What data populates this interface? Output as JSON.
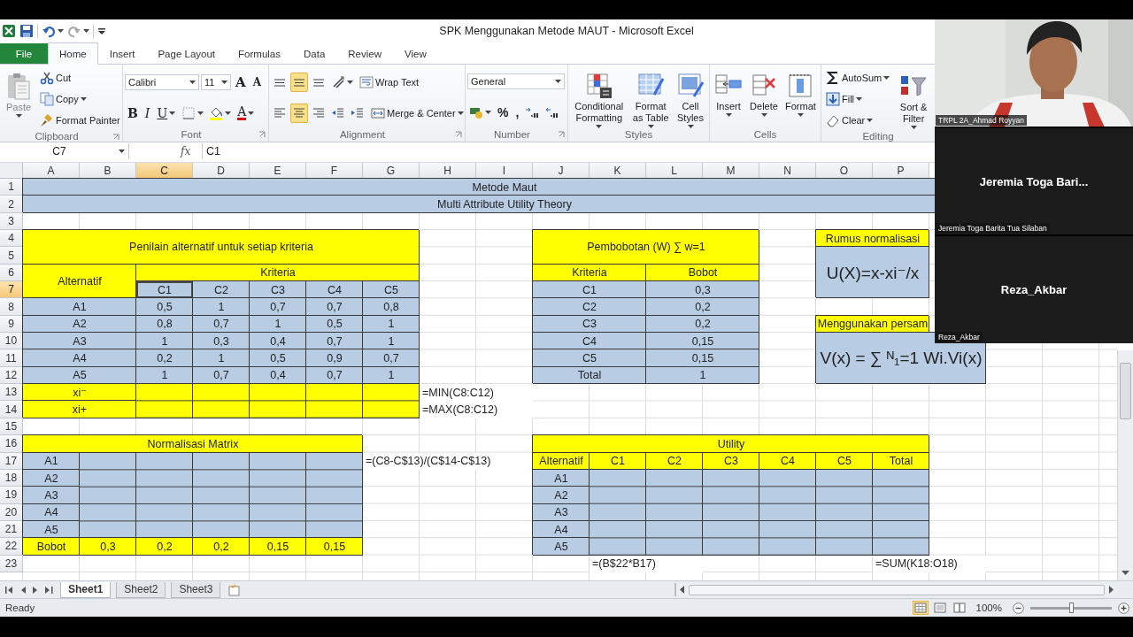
{
  "window": {
    "title": "SPK Menggunakan Metode MAUT - Microsoft Excel"
  },
  "quick_access": [
    {
      "kind": "excel",
      "menu": false
    },
    {
      "kind": "save",
      "menu": false
    },
    {
      "kind": "undo",
      "menu": true
    },
    {
      "kind": "redo",
      "menu": true
    },
    {
      "kind": "customize",
      "menu": false
    }
  ],
  "tabs": [
    {
      "label": "File",
      "kind": "file",
      "selected": false
    },
    {
      "label": "Home",
      "kind": "tab",
      "selected": true
    },
    {
      "label": "Insert",
      "kind": "tab",
      "selected": false
    },
    {
      "label": "Page Layout",
      "kind": "tab",
      "selected": false
    },
    {
      "label": "Formulas",
      "kind": "tab",
      "selected": false
    },
    {
      "label": "Data",
      "kind": "tab",
      "selected": false
    },
    {
      "label": "Review",
      "kind": "tab",
      "selected": false
    },
    {
      "label": "View",
      "kind": "tab",
      "selected": false
    }
  ],
  "ribbon": {
    "groups": [
      {
        "label": "Clipboard",
        "launcher": true,
        "columns": [
          [
            [
              {
                "kind": "paste",
                "label": "Paste",
                "menu": true,
                "selected": false
              }
            ]
          ],
          [
            [
              {
                "kind": "cut",
                "label": "Cut",
                "menu": false,
                "selected": false
              }
            ],
            [
              {
                "kind": "copy",
                "label": "Copy",
                "menu": true,
                "selected": false
              }
            ],
            [
              {
                "kind": "painter",
                "label": "Format Painter",
                "menu": false,
                "selected": false
              }
            ]
          ]
        ]
      },
      {
        "label": "Font",
        "launcher": true,
        "columns": [
          [
            [
              {
                "kind": "font-name",
                "label": "Calibri",
                "menu": true,
                "selected": false
              },
              {
                "kind": "font-size",
                "label": "11",
                "menu": true,
                "selected": false
              },
              {
                "kind": "grow",
                "label": "A",
                "menu": false,
                "selected": false
              },
              {
                "kind": "shrink",
                "label": "A",
                "menu": false,
                "selected": false
              }
            ],
            [
              {
                "kind": "bold",
                "label": "B",
                "menu": false,
                "selected": false
              },
              {
                "kind": "italic",
                "label": "I",
                "menu": false,
                "selected": false
              },
              {
                "kind": "underline",
                "label": "U",
                "menu": true,
                "selected": false
              },
              {
                "kind": "borders",
                "menu": true,
                "selected": false
              },
              {
                "kind": "fill-color",
                "menu": true,
                "selected": false
              },
              {
                "kind": "font-color",
                "label": "A",
                "menu": true,
                "selected": false
              }
            ]
          ]
        ]
      },
      {
        "label": "Alignment",
        "launcher": true,
        "columns": [
          [
            [
              {
                "kind": "align-top",
                "menu": false,
                "selected": false
              },
              {
                "kind": "align-middle",
                "menu": false,
                "selected": true
              },
              {
                "kind": "align-bottom",
                "menu": false,
                "selected": false
              },
              {
                "kind": "orientation",
                "menu": true,
                "selected": false
              },
              {
                "kind": "wrap",
                "label": "Wrap Text",
                "menu": false,
                "selected": false
              }
            ],
            [
              {
                "kind": "align-left",
                "menu": false,
                "selected": false
              },
              {
                "kind": "align-center",
                "menu": false,
                "selected": true
              },
              {
                "kind": "align-right",
                "menu": false,
                "selected": false
              },
              {
                "kind": "outdent",
                "menu": false,
                "selected": false
              },
              {
                "kind": "indent",
                "menu": false,
                "selected": false
              },
              {
                "kind": "merge",
                "label": "Merge & Center",
                "menu": true,
                "selected": false
              }
            ]
          ]
        ]
      },
      {
        "label": "Number",
        "launcher": true,
        "columns": [
          [
            [
              {
                "kind": "number-format",
                "label": "General",
                "menu": true,
                "selected": false
              }
            ],
            [
              {
                "kind": "currency",
                "menu": true,
                "selected": false
              },
              {
                "kind": "percent",
                "label": "%",
                "menu": false,
                "selected": false
              },
              {
                "kind": "comma",
                "label": ",",
                "menu": false,
                "selected": false
              },
              {
                "kind": "inc-decimal",
                "menu": false,
                "selected": false
              },
              {
                "kind": "dec-decimal",
                "menu": false,
                "selected": false
              }
            ]
          ]
        ]
      },
      {
        "label": "Styles",
        "launcher": false,
        "columns": [
          [
            [
              {
                "kind": "conditional",
                "label": "Conditional Formatting",
                "menu": true,
                "selected": false
              }
            ]
          ],
          [
            [
              {
                "kind": "format-table",
                "label": "Format as Table",
                "menu": true,
                "selected": false
              }
            ]
          ],
          [
            [
              {
                "kind": "cell-styles",
                "label": "Cell Styles",
                "menu": true,
                "selected": false
              }
            ]
          ]
        ]
      },
      {
        "label": "Cells",
        "launcher": false,
        "columns": [
          [
            [
              {
                "kind": "insert-cells",
                "label": "Insert",
                "menu": true,
                "selected": false
              }
            ]
          ],
          [
            [
              {
                "kind": "delete-cells",
                "label": "Delete",
                "menu": true,
                "selected": false
              }
            ]
          ],
          [
            [
              {
                "kind": "format-cells",
                "label": "Format",
                "menu": true,
                "selected": false
              }
            ]
          ]
        ]
      },
      {
        "label": "Editing",
        "launcher": false,
        "columns": [
          [
            [
              {
                "kind": "autosum",
                "label": "AutoSum",
                "menu": true,
                "selected": false
              }
            ],
            [
              {
                "kind": "fill",
                "label": "Fill",
                "menu": true,
                "selected": false
              }
            ],
            [
              {
                "kind": "clear",
                "label": "Clear",
                "menu": true,
                "selected": false
              }
            ]
          ],
          [
            [
              {
                "kind": "sort",
                "label": "Sort & Filter",
                "menu": true,
                "selected": false
              }
            ]
          ]
        ]
      }
    ]
  },
  "formula_bar": {
    "name_box": "C7",
    "fx": "fx",
    "formula": "C1"
  },
  "sheet": {
    "columns": [
      {
        "label": "A",
        "selected": false
      },
      {
        "label": "B",
        "selected": false
      },
      {
        "label": "C",
        "selected": true
      },
      {
        "label": "D",
        "selected": false
      },
      {
        "label": "E",
        "selected": false
      },
      {
        "label": "F",
        "selected": false
      },
      {
        "label": "G",
        "selected": false
      },
      {
        "label": "H",
        "selected": false
      },
      {
        "label": "I",
        "selected": false
      },
      {
        "label": "J",
        "selected": false
      },
      {
        "label": "K",
        "selected": false
      },
      {
        "label": "L",
        "selected": false
      },
      {
        "label": "M",
        "selected": false
      },
      {
        "label": "N",
        "selected": false
      },
      {
        "label": "O",
        "selected": false
      },
      {
        "label": "P",
        "selected": false
      }
    ],
    "rows": [
      {
        "label": "1",
        "selected": false
      },
      {
        "label": "2",
        "selected": false
      },
      {
        "label": "3",
        "selected": false
      },
      {
        "label": "4",
        "selected": false
      },
      {
        "label": "5",
        "selected": false
      },
      {
        "label": "6",
        "selected": false
      },
      {
        "label": "7",
        "selected": true
      },
      {
        "label": "8",
        "selected": false
      },
      {
        "label": "9",
        "selected": false
      },
      {
        "label": "10",
        "selected": false
      },
      {
        "label": "11",
        "selected": false
      },
      {
        "label": "12",
        "selected": false
      },
      {
        "label": "13",
        "selected": false
      },
      {
        "label": "14",
        "selected": false
      },
      {
        "label": "15",
        "selected": false
      },
      {
        "label": "16",
        "selected": false
      },
      {
        "label": "17",
        "selected": false
      },
      {
        "label": "18",
        "selected": false
      },
      {
        "label": "19",
        "selected": false
      },
      {
        "label": "20",
        "selected": false
      },
      {
        "label": "21",
        "selected": false
      },
      {
        "label": "22",
        "selected": false
      },
      {
        "label": "23",
        "selected": false
      }
    ],
    "cells": [
      {
        "text": "Metode Maut",
        "color": "#b8cce4",
        "selected": false
      },
      {
        "text": "Multi Attribute Utility Theory",
        "color": "#b8cce4",
        "selected": false
      },
      {
        "text": "Penilain alternatif untuk setiap kriteria",
        "color": "#ffff00",
        "selected": false
      },
      {
        "text": "Pembobotan (W) ∑ w=1",
        "color": "#ffff00",
        "selected": false
      },
      {
        "text": "Rumus normalisasi",
        "color": "#ffff00",
        "selected": false
      },
      {
        "text": "Alternatif",
        "color": "#ffff00",
        "selected": false
      },
      {
        "text": "Kriteria",
        "color": "#ffff00",
        "selected": false
      },
      {
        "text": "Kriteria",
        "color": "#ffff00",
        "selected": false
      },
      {
        "text": "Bobot",
        "color": "#ffff00",
        "selected": false
      },
      {
        "text": "U(X)=x-xi⁻/x",
        "color": "#b8cce4",
        "kind": "big",
        "selected": false
      },
      {
        "text": "C1",
        "color": "#b8cce4",
        "selected": true
      },
      {
        "text": "C2",
        "color": "#b8cce4",
        "selected": false
      },
      {
        "text": "C3",
        "color": "#b8cce4",
        "selected": false
      },
      {
        "text": "C4",
        "color": "#b8cce4",
        "selected": false
      },
      {
        "text": "C5",
        "color": "#b8cce4",
        "selected": false
      },
      {
        "text": "C1",
        "color": "#b8cce4",
        "selected": false
      },
      {
        "text": "0,3",
        "color": "#b8cce4",
        "selected": false
      },
      {
        "text": "A1",
        "color": "#b8cce4",
        "selected": false
      },
      {
        "text": "0,5",
        "color": "#b8cce4",
        "selected": false
      },
      {
        "text": "1",
        "color": "#b8cce4",
        "selected": false
      },
      {
        "text": "0,7",
        "color": "#b8cce4",
        "selected": false
      },
      {
        "text": "0,7",
        "color": "#b8cce4",
        "selected": false
      },
      {
        "text": "0,8",
        "color": "#b8cce4",
        "selected": false
      },
      {
        "text": "C2",
        "color": "#b8cce4",
        "selected": false
      },
      {
        "text": "0,2",
        "color": "#b8cce4",
        "selected": false
      },
      {
        "text": "A2",
        "color": "#b8cce4",
        "selected": false
      },
      {
        "text": "0,8",
        "color": "#b8cce4",
        "selected": false
      },
      {
        "text": "0,7",
        "color": "#b8cce4",
        "selected": false
      },
      {
        "text": "1",
        "color": "#b8cce4",
        "selected": false
      },
      {
        "text": "0,5",
        "color": "#b8cce4",
        "selected": false
      },
      {
        "text": "1",
        "color": "#b8cce4",
        "selected": false
      },
      {
        "text": "C3",
        "color": "#b8cce4",
        "selected": false
      },
      {
        "text": "0,2",
        "color": "#b8cce4",
        "selected": false
      },
      {
        "text": "Menggunakan persam",
        "color": "#ffff00",
        "selected": false
      },
      {
        "text": "A3",
        "color": "#b8cce4",
        "selected": false
      },
      {
        "text": "1",
        "color": "#b8cce4",
        "selected": false
      },
      {
        "text": "0,3",
        "color": "#b8cce4",
        "selected": false
      },
      {
        "text": "0,4",
        "color": "#b8cce4",
        "selected": false
      },
      {
        "text": "0,7",
        "color": "#b8cce4",
        "selected": false
      },
      {
        "text": "1",
        "color": "#b8cce4",
        "selected": false
      },
      {
        "text": "C4",
        "color": "#b8cce4",
        "selected": false
      },
      {
        "text": "0,15",
        "color": "#b8cce4",
        "selected": false
      },
      {
        "text": "A4",
        "color": "#b8cce4",
        "selected": false
      },
      {
        "text": "0,2",
        "color": "#b8cce4",
        "selected": false
      },
      {
        "text": "1",
        "color": "#b8cce4",
        "selected": false
      },
      {
        "text": "0,5",
        "color": "#b8cce4",
        "selected": false
      },
      {
        "text": "0,9",
        "color": "#b8cce4",
        "selected": false
      },
      {
        "text": "0,7",
        "color": "#b8cce4",
        "selected": false
      },
      {
        "text": "C5",
        "color": "#b8cce4",
        "selected": false
      },
      {
        "text": "0,15",
        "color": "#b8cce4",
        "selected": false
      },
      {
        "text": "V(x) = ∑ ᴺ₁=1 Wi.Vi(x)",
        "color": "#b8cce4",
        "kind": "big",
        "selected": false
      },
      {
        "text": "A5",
        "color": "#b8cce4",
        "selected": false
      },
      {
        "text": "1",
        "color": "#b8cce4",
        "selected": false
      },
      {
        "text": "0,7",
        "color": "#b8cce4",
        "selected": false
      },
      {
        "text": "0,4",
        "color": "#b8cce4",
        "selected": false
      },
      {
        "text": "0,7",
        "color": "#b8cce4",
        "selected": false
      },
      {
        "text": "1",
        "color": "#b8cce4",
        "selected": false
      },
      {
        "text": "Total",
        "color": "#b8cce4",
        "selected": false
      },
      {
        "text": "1",
        "color": "#b8cce4",
        "selected": false
      },
      {
        "text": "xi⁻",
        "color": "#ffff00",
        "selected": false
      },
      {
        "color": "#ffff00",
        "selected": false
      },
      {
        "text": "=MIN(C8:C12)",
        "selected": false
      },
      {
        "text": "xi+",
        "color": "#ffff00",
        "selected": false
      },
      {
        "text": "=MAX(C8:C12)",
        "selected": false
      },
      {
        "text": "Normalisasi Matrix",
        "color": "#ffff00",
        "selected": false
      },
      {
        "text": "Utility",
        "color": "#ffff00",
        "selected": false
      },
      {
        "text": "A1",
        "color": "#b8cce4",
        "selected": false
      },
      {
        "color": "#b8cce4",
        "selected": false
      },
      {
        "text": "=(C8-C$13)/(C$14-C$13)",
        "selected": false
      },
      {
        "text": "Alternatif",
        "color": "#ffff00",
        "selected": false
      },
      {
        "text": "C1",
        "color": "#ffff00",
        "selected": false
      },
      {
        "text": "C2",
        "color": "#ffff00",
        "selected": false
      },
      {
        "text": "C3",
        "color": "#ffff00",
        "selected": false
      },
      {
        "text": "C4",
        "color": "#ffff00",
        "selected": false
      },
      {
        "text": "C5",
        "color": "#ffff00",
        "selected": false
      },
      {
        "text": "Total",
        "color": "#ffff00",
        "selected": false
      },
      {
        "text": "A2",
        "color": "#b8cce4",
        "selected": false
      },
      {
        "text": "A1",
        "color": "#b8cce4",
        "selected": false
      },
      {
        "color": "#b8cce4",
        "selected": false
      },
      {
        "text": "A3",
        "color": "#b8cce4",
        "selected": false
      },
      {
        "text": "A2",
        "color": "#b8cce4",
        "selected": false
      },
      {
        "text": "A4",
        "color": "#b8cce4",
        "selected": false
      },
      {
        "text": "A3",
        "color": "#b8cce4",
        "selected": false
      },
      {
        "text": "A5",
        "color": "#b8cce4",
        "selected": false
      },
      {
        "text": "A4",
        "color": "#b8cce4",
        "selected": false
      },
      {
        "text": "Bobot",
        "color": "#ffff00",
        "selected": false
      },
      {
        "text": "0,3",
        "color": "#ffff00",
        "selected": false
      },
      {
        "text": "0,2",
        "color": "#ffff00",
        "selected": false
      },
      {
        "text": "0,2",
        "color": "#ffff00",
        "selected": false
      },
      {
        "text": "0,15",
        "color": "#ffff00",
        "selected": false
      },
      {
        "text": "0,15",
        "color": "#ffff00",
        "selected": false
      },
      {
        "text": "A5",
        "color": "#b8cce4",
        "selected": false
      },
      {
        "text": "=(B$22*B17)",
        "selected": false
      },
      {
        "text": "=SUM(K18:O18)",
        "selected": false
      }
    ]
  },
  "sheet_tabs": [
    {
      "label": "Sheet1",
      "selected": true
    },
    {
      "label": "Sheet2",
      "selected": false
    },
    {
      "label": "Sheet3",
      "selected": false
    }
  ],
  "status_bar": {
    "text": "Ready",
    "views": [
      {
        "kind": "normal",
        "selected": true
      },
      {
        "kind": "page-layout",
        "selected": false
      },
      {
        "kind": "page-break",
        "selected": false
      }
    ],
    "zoom": "100%",
    "zoom_slider": {
      "level": 0.5
    }
  },
  "participants": [
    {
      "kind": "camera",
      "name": "TRPL 2A_Ahmad Royyan"
    },
    {
      "kind": "no-video",
      "display": "Jeremia Toga Bari...",
      "name": "Jeremia Toga Barita Tua Silaban"
    },
    {
      "kind": "no-video",
      "display": "Reza_Akbar",
      "name": "Reza_Akbar"
    }
  ]
}
